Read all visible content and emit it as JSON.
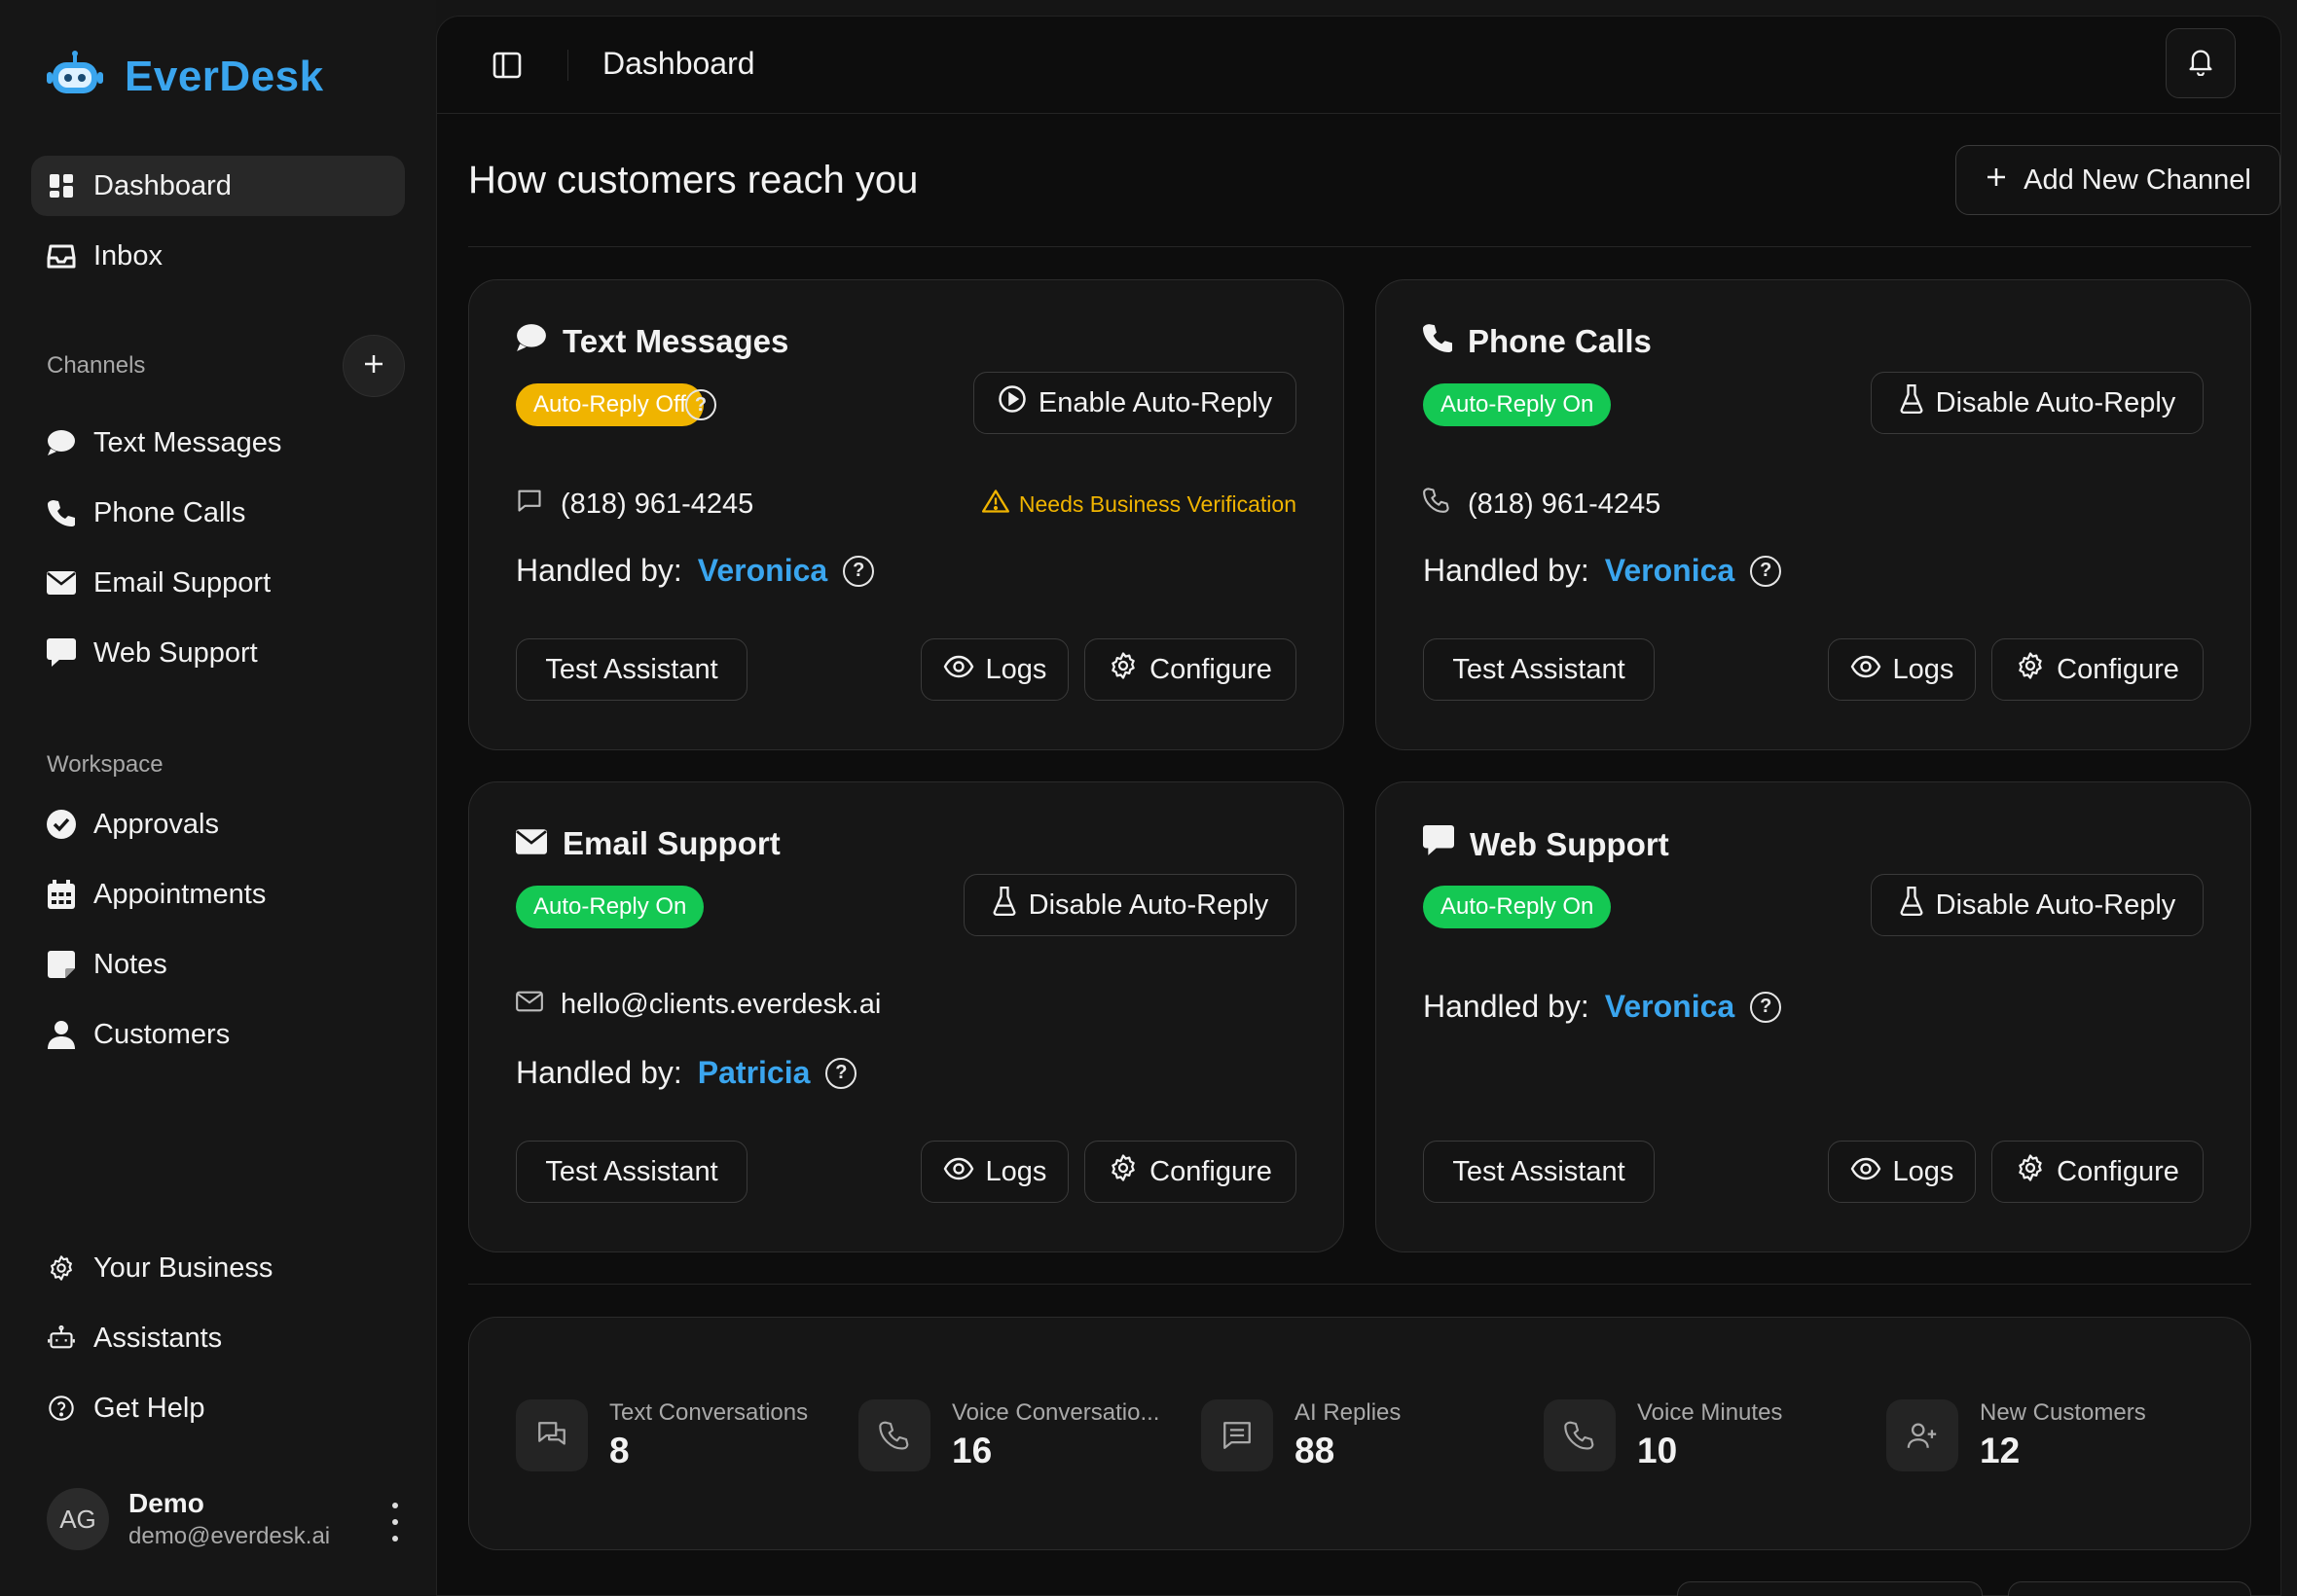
{
  "app": {
    "name": "EverDesk"
  },
  "sidebar": {
    "main_items": [
      {
        "label": "Dashboard",
        "icon": "grid-icon",
        "active": true
      },
      {
        "label": "Inbox",
        "icon": "inbox-icon"
      }
    ],
    "channels_label": "Channels",
    "channels": [
      {
        "label": "Text Messages",
        "icon": "chat-bubble-icon"
      },
      {
        "label": "Phone Calls",
        "icon": "phone-icon"
      },
      {
        "label": "Email Support",
        "icon": "envelope-icon"
      },
      {
        "label": "Web Support",
        "icon": "message-square-icon"
      }
    ],
    "workspace_label": "Workspace",
    "workspace": [
      {
        "label": "Approvals",
        "icon": "check-circle-icon"
      },
      {
        "label": "Appointments",
        "icon": "calendar-icon"
      },
      {
        "label": "Notes",
        "icon": "note-icon"
      },
      {
        "label": "Customers",
        "icon": "person-icon"
      }
    ],
    "bottom": [
      {
        "label": "Your Business",
        "icon": "gear-icon"
      },
      {
        "label": "Assistants",
        "icon": "bot-icon"
      },
      {
        "label": "Get Help",
        "icon": "help-circle-icon"
      }
    ],
    "user": {
      "initials": "AG",
      "name": "Demo",
      "email": "demo@everdesk.ai"
    }
  },
  "header": {
    "title": "Dashboard"
  },
  "main": {
    "headline": "How customers reach you",
    "add_channel_label": "Add New Channel",
    "cards": [
      {
        "title": "Text Messages",
        "badge": "Auto-Reply Off",
        "badge_state": "off",
        "toggle_label": "Enable Auto-Reply",
        "contact": "(818) 961-4245",
        "warning": "Needs Business Verification",
        "handled_label": "Handled by:",
        "assistant": "Veronica",
        "test_label": "Test Assistant",
        "logs_label": "Logs",
        "configure_label": "Configure"
      },
      {
        "title": "Phone Calls",
        "badge": "Auto-Reply On",
        "badge_state": "on",
        "toggle_label": "Disable Auto-Reply",
        "contact": "(818) 961-4245",
        "handled_label": "Handled by:",
        "assistant": "Veronica",
        "test_label": "Test Assistant",
        "logs_label": "Logs",
        "configure_label": "Configure"
      },
      {
        "title": "Email Support",
        "badge": "Auto-Reply On",
        "badge_state": "on",
        "toggle_label": "Disable Auto-Reply",
        "contact": "hello@clients.everdesk.ai",
        "handled_label": "Handled by:",
        "assistant": "Patricia",
        "test_label": "Test Assistant",
        "logs_label": "Logs",
        "configure_label": "Configure"
      },
      {
        "title": "Web Support",
        "badge": "Auto-Reply On",
        "badge_state": "on",
        "toggle_label": "Disable Auto-Reply",
        "handled_label": "Handled by:",
        "assistant": "Veronica",
        "test_label": "Test Assistant",
        "logs_label": "Logs",
        "configure_label": "Configure"
      }
    ],
    "stats": [
      {
        "label": "Text Conversations",
        "value": "8",
        "icon": "chat-icon"
      },
      {
        "label": "Voice Conversatio...",
        "value": "16",
        "icon": "phone-icon"
      },
      {
        "label": "AI Replies",
        "value": "88",
        "icon": "message-lines-icon"
      },
      {
        "label": "Voice Minutes",
        "value": "10",
        "icon": "phone-icon"
      },
      {
        "label": "New Customers",
        "value": "12",
        "icon": "user-plus-icon"
      }
    ]
  },
  "colors": {
    "accent": "#3aa5ee",
    "badge_off": "#f0b400",
    "badge_on": "#14c853",
    "warning": "#f0b400",
    "background": "#0d0d0d",
    "card": "#161616"
  }
}
